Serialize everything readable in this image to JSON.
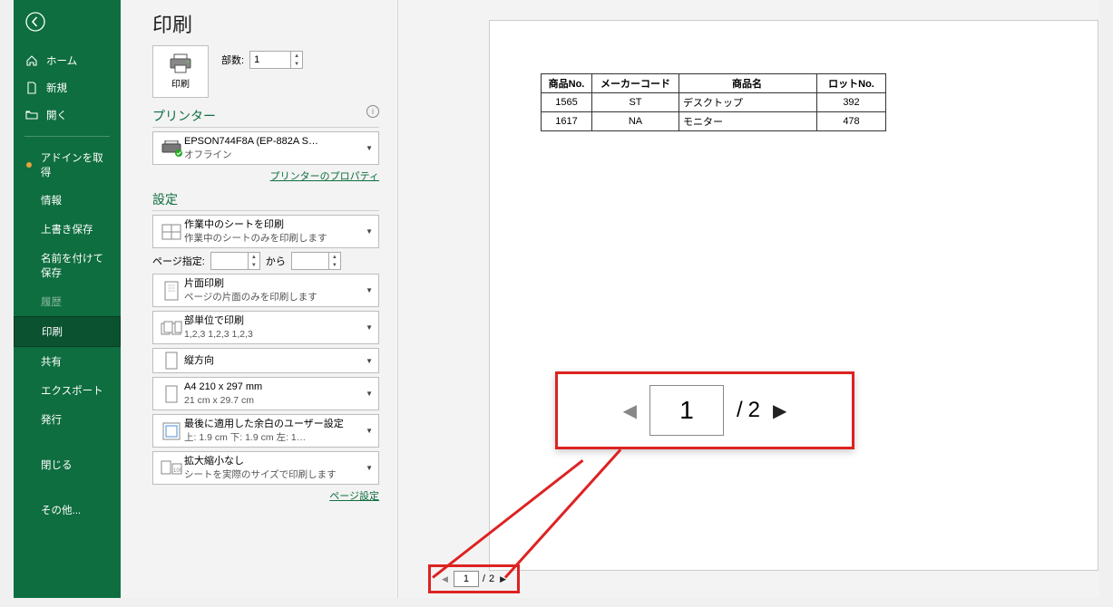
{
  "sidebar": {
    "items": [
      {
        "label": "ホーム",
        "icon": "home"
      },
      {
        "label": "新規",
        "icon": "file"
      },
      {
        "label": "開く",
        "icon": "folder-open"
      }
    ],
    "addins_label": "アドインを取得",
    "subs": [
      {
        "label": "情報"
      },
      {
        "label": "上書き保存"
      },
      {
        "label": "名前を付けて保存"
      },
      {
        "label": "履歴",
        "disabled": true
      },
      {
        "label": "印刷",
        "active": true
      },
      {
        "label": "共有"
      },
      {
        "label": "エクスポート"
      },
      {
        "label": "発行"
      },
      {
        "label": "閉じる"
      },
      {
        "label": "その他..."
      }
    ]
  },
  "page_title": "印刷",
  "print_button_label": "印刷",
  "copies_label": "部数:",
  "copies_value": "1",
  "printer_section": "プリンター",
  "printer_name": "EPSON744F8A (EP-882A S…",
  "printer_status": "オフライン",
  "printer_props_link": "プリンターのプロパティ",
  "settings_section": "設定",
  "settings": [
    {
      "line1": "作業中のシートを印刷",
      "line2": "作業中のシートのみを印刷します",
      "icon": "sheet"
    },
    {
      "line1": "片面印刷",
      "line2": "ページの片面のみを印刷します",
      "icon": "page"
    },
    {
      "line1": "部単位で印刷",
      "line2": "1,2,3    1,2,3    1,2,3",
      "icon": "collate"
    },
    {
      "line1": "縦方向",
      "line2": "",
      "icon": "portrait"
    },
    {
      "line1": "A4 210 x 297 mm",
      "line2": "21 cm x 29.7 cm",
      "icon": "papersize"
    },
    {
      "line1": "最後に適用した余白のユーザー設定",
      "line2": "上: 1.9 cm 下: 1.9 cm 左: 1…",
      "icon": "margins"
    },
    {
      "line1": "拡大縮小なし",
      "line2": "シートを実際のサイズで印刷します",
      "icon": "scale"
    }
  ],
  "page_range": {
    "label": "ページ指定:",
    "from": "",
    "sep": "から",
    "to": ""
  },
  "page_setup_link": "ページ設定",
  "preview": {
    "headers": [
      "商品No.",
      "メーカーコード",
      "商品名",
      "ロットNo."
    ],
    "rows": [
      [
        "1565",
        "ST",
        "デスクトップ",
        "392"
      ],
      [
        "1617",
        "NA",
        "モニター",
        "478"
      ]
    ]
  },
  "pager": {
    "current": "1",
    "sep": "/",
    "total": "2"
  },
  "callout": {
    "current": "1",
    "sep": "/",
    "total": "2"
  }
}
